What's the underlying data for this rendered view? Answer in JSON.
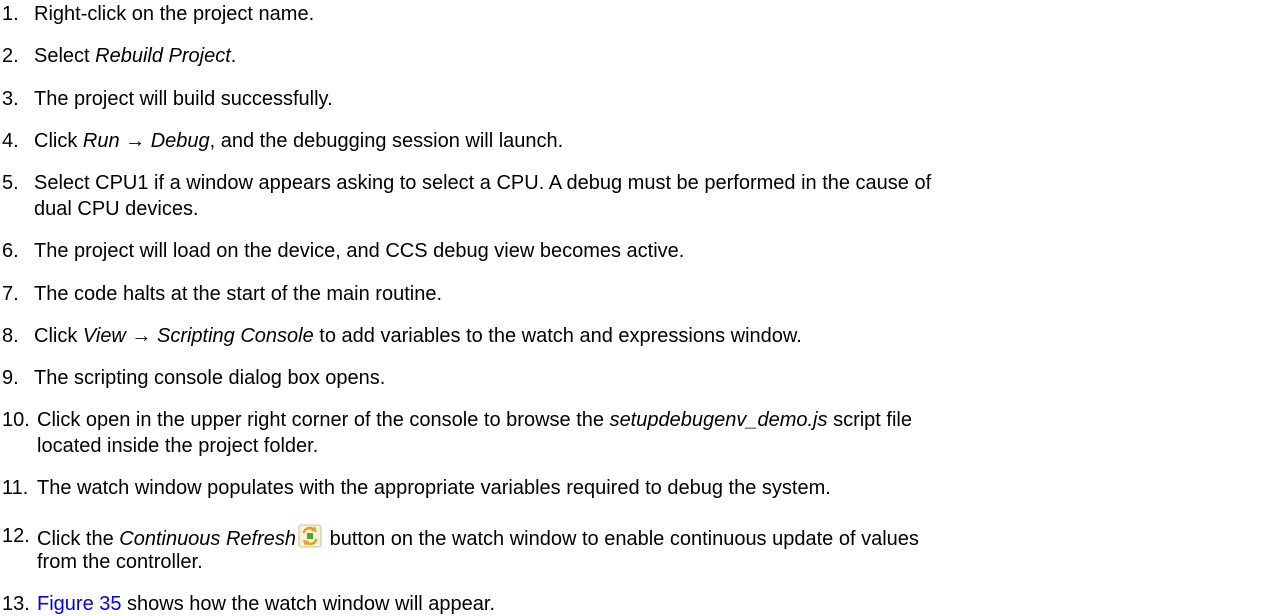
{
  "steps": [
    {
      "num": "1.",
      "parts": [
        {
          "t": "Right-click on the project name."
        }
      ]
    },
    {
      "num": "2.",
      "parts": [
        {
          "t": "Select "
        },
        {
          "t": "Rebuild Project",
          "em": true
        },
        {
          "t": "."
        }
      ]
    },
    {
      "num": "3.",
      "parts": [
        {
          "t": "The project will build successfully."
        }
      ]
    },
    {
      "num": "4.",
      "parts": [
        {
          "t": "Click "
        },
        {
          "t": "Run → Debug",
          "em": true
        },
        {
          "t": ", and the debugging session will launch."
        }
      ]
    },
    {
      "num": "5.",
      "parts": [
        {
          "t": "Select CPU1 if a window appears asking to select a CPU. A debug must be performed in the cause of"
        }
      ],
      "cont": "dual CPU devices."
    },
    {
      "num": "6.",
      "parts": [
        {
          "t": "The project will load on the device, and CCS debug view becomes active."
        }
      ]
    },
    {
      "num": "7.",
      "parts": [
        {
          "t": "The code halts at the start of the main routine."
        }
      ]
    },
    {
      "num": "8.",
      "parts": [
        {
          "t": "Click "
        },
        {
          "t": "View → Scripting Console",
          "em": true
        },
        {
          "t": " to add variables to the watch and expressions window."
        }
      ]
    },
    {
      "num": "9.",
      "parts": [
        {
          "t": "The scripting console dialog box opens."
        }
      ]
    },
    {
      "num": "10.",
      "parts": [
        {
          "t": "Click open in the upper right corner of the console to browse the "
        },
        {
          "t": "setupdebugenv_demo.js",
          "em": true
        },
        {
          "t": " script file"
        }
      ],
      "cont": "located inside the project folder."
    },
    {
      "num": "11.",
      "parts": [
        {
          "t": "The watch window populates with the appropriate variables required to debug the system."
        }
      ]
    },
    {
      "num": "12.",
      "parts": [
        {
          "t": "Click the "
        },
        {
          "t": "Continuous Refresh",
          "em": true
        },
        {
          "icon": "continuous-refresh-icon"
        },
        {
          "t": " button on the watch window to enable continuous update of values"
        }
      ],
      "cont": "from the controller."
    },
    {
      "num": "13.",
      "parts": [
        {
          "t": "Figure 35",
          "link": true
        },
        {
          "t": " shows how the watch window will appear."
        }
      ]
    }
  ],
  "colors": {
    "text": "#000000",
    "link": "#0000ff",
    "icon_orange": "#e8a317",
    "icon_green": "#5aa02c"
  }
}
